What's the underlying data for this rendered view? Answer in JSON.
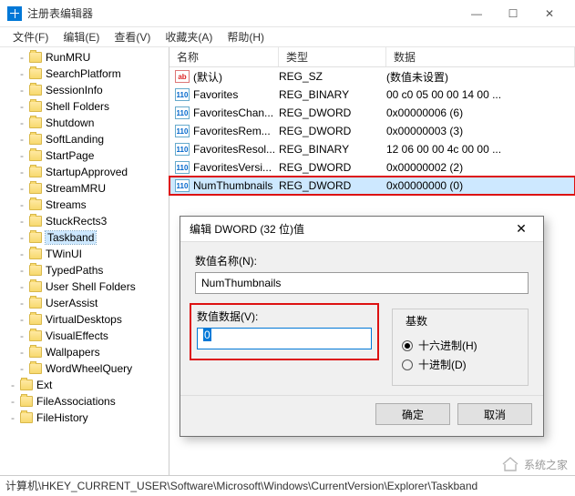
{
  "window": {
    "title": "注册表编辑器"
  },
  "menu": {
    "file": "文件(F)",
    "edit": "编辑(E)",
    "view": "查看(V)",
    "fav": "收藏夹(A)",
    "help": "帮助(H)"
  },
  "tree": {
    "items": [
      "RunMRU",
      "SearchPlatform",
      "SessionInfo",
      "Shell Folders",
      "Shutdown",
      "SoftLanding",
      "StartPage",
      "StartupApproved",
      "StreamMRU",
      "Streams",
      "StuckRects3",
      "Taskband",
      "TWinUI",
      "TypedPaths",
      "User Shell Folders",
      "UserAssist",
      "VirtualDesktops",
      "VisualEffects",
      "Wallpapers",
      "WordWheelQuery"
    ],
    "l2": [
      "Ext",
      "FileAssociations",
      "FileHistory"
    ],
    "selected": "Taskband"
  },
  "columns": {
    "name": "名称",
    "type": "类型",
    "data": "数据"
  },
  "values": [
    {
      "icon": "str",
      "name": "(默认)",
      "type": "REG_SZ",
      "data": "(数值未设置)"
    },
    {
      "icon": "bin",
      "name": "Favorites",
      "type": "REG_BINARY",
      "data": "00 c0 05 00 00 14 00 ..."
    },
    {
      "icon": "bin",
      "name": "FavoritesChan...",
      "type": "REG_DWORD",
      "data": "0x00000006 (6)"
    },
    {
      "icon": "bin",
      "name": "FavoritesRem...",
      "type": "REG_DWORD",
      "data": "0x00000003 (3)"
    },
    {
      "icon": "bin",
      "name": "FavoritesResol...",
      "type": "REG_BINARY",
      "data": "12 06 00 00 4c 00 00 ..."
    },
    {
      "icon": "bin",
      "name": "FavoritesVersi...",
      "type": "REG_DWORD",
      "data": "0x00000002 (2)"
    },
    {
      "icon": "bin",
      "name": "NumThumbnails",
      "type": "REG_DWORD",
      "data": "0x00000000 (0)",
      "selected": true
    }
  ],
  "dialog": {
    "title": "编辑 DWORD (32 位)值",
    "name_label": "数值名称(N):",
    "name_value": "NumThumbnails",
    "data_label": "数值数据(V):",
    "data_value": "0",
    "base_label": "基数",
    "radio_hex": "十六进制(H)",
    "radio_dec": "十进制(D)",
    "ok": "确定",
    "cancel": "取消"
  },
  "statusbar": "计算机\\HKEY_CURRENT_USER\\Software\\Microsoft\\Windows\\CurrentVersion\\Explorer\\Taskband",
  "watermark": "系统之家"
}
